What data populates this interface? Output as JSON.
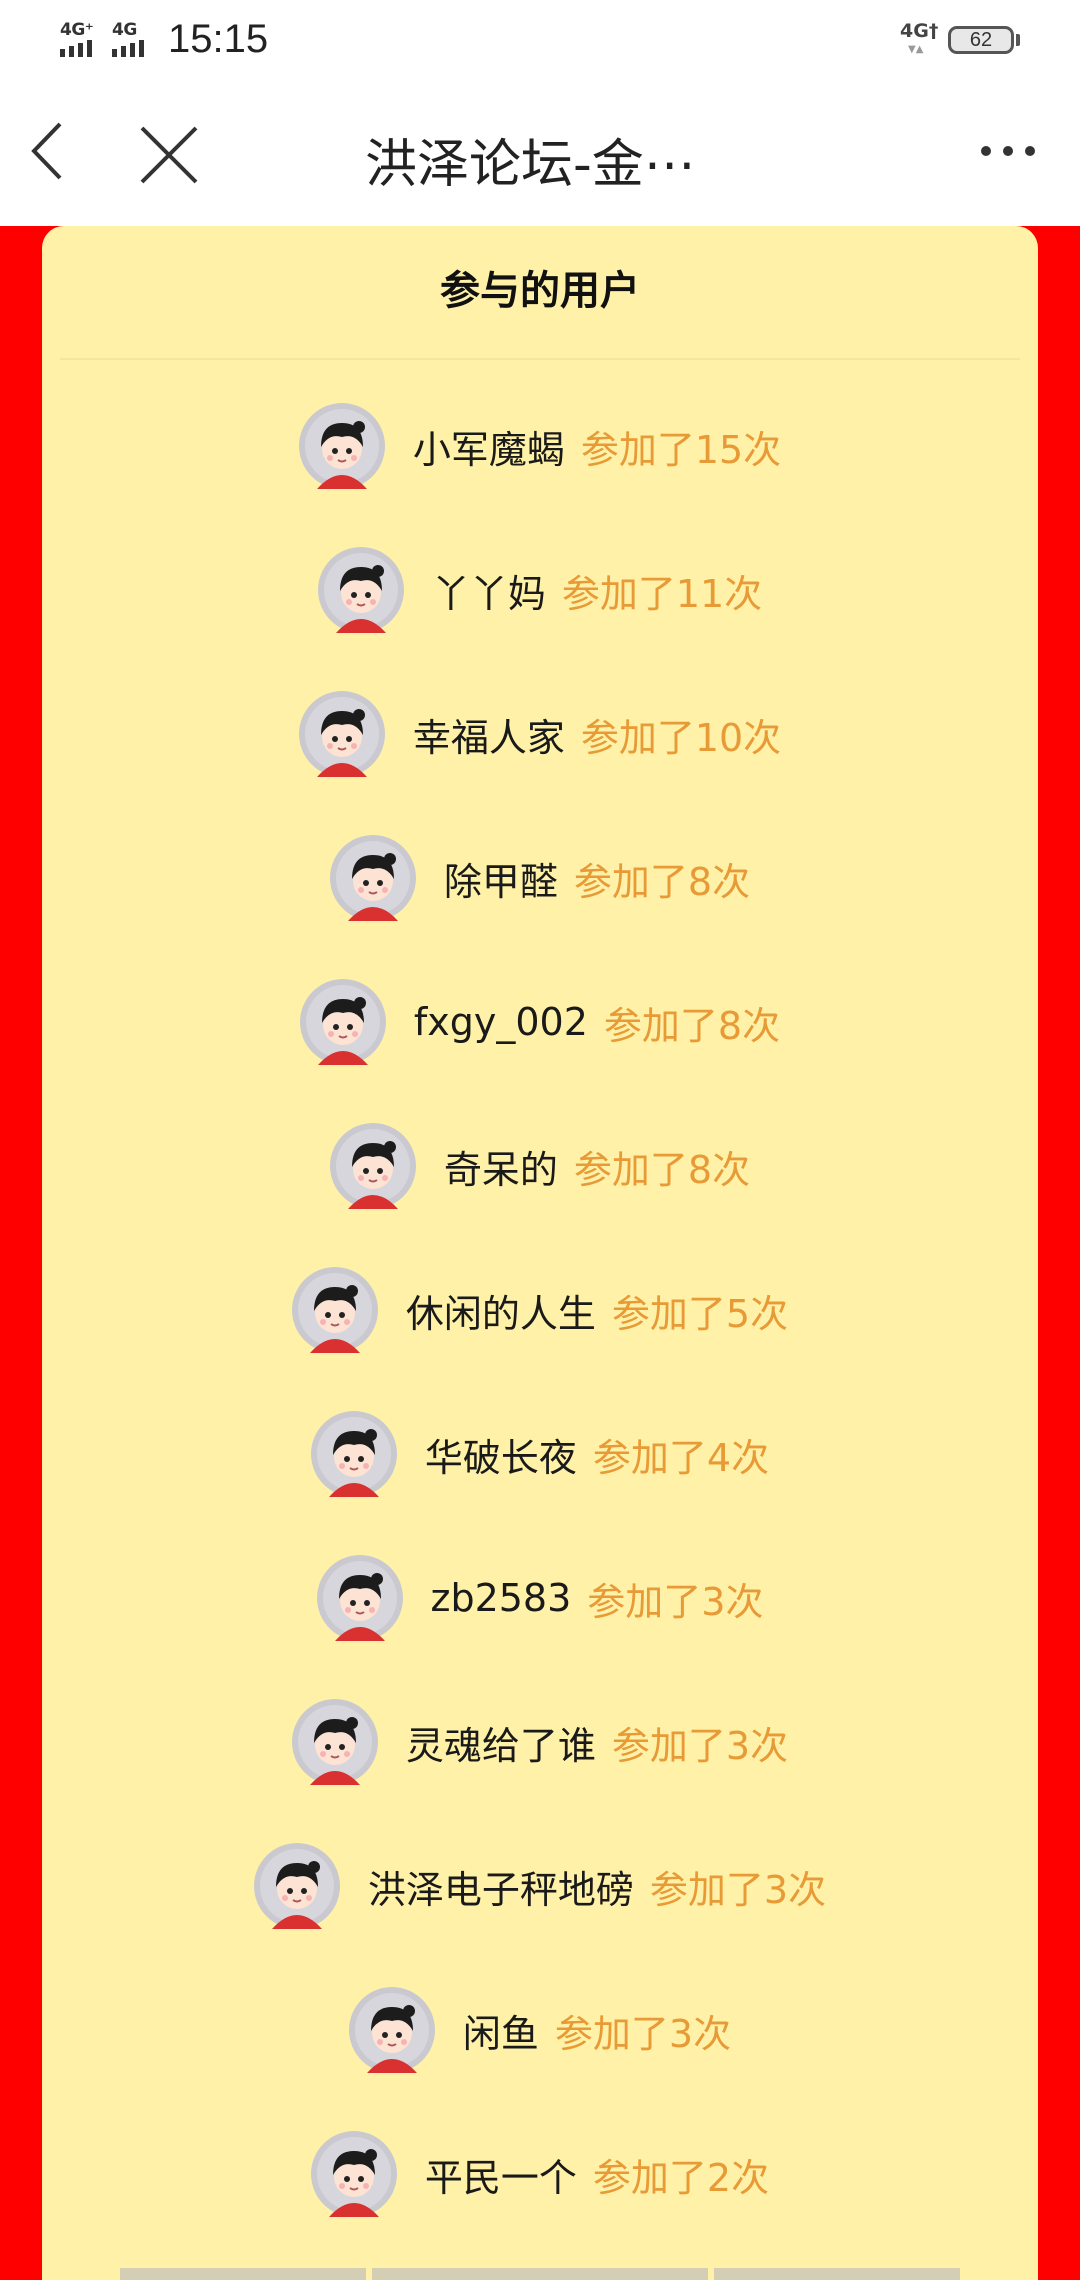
{
  "status_bar": {
    "sim1_label": "4G⁺",
    "sim2_label": "4G",
    "time": "15:15",
    "network_right": "4G†",
    "battery": "62"
  },
  "nav": {
    "title": "洪泽论坛-金⋯"
  },
  "card": {
    "title": "参与的用户"
  },
  "users": [
    {
      "name": "小军魔蝎",
      "count": "参加了15次"
    },
    {
      "name": "丫丫妈",
      "count": "参加了11次"
    },
    {
      "name": "幸福人家",
      "count": "参加了10次"
    },
    {
      "name": "除甲醛",
      "count": "参加了8次"
    },
    {
      "name": "fxgy_002",
      "count": "参加了8次"
    },
    {
      "name": "奇呆的",
      "count": "参加了8次"
    },
    {
      "name": "休闲的人生",
      "count": "参加了5次"
    },
    {
      "name": "华破长夜",
      "count": "参加了4次"
    },
    {
      "name": "zb2583",
      "count": "参加了3次"
    },
    {
      "name": "灵魂给了谁",
      "count": "参加了3次"
    },
    {
      "name": "洪泽电子秤地磅",
      "count": "参加了3次"
    },
    {
      "name": "闲鱼",
      "count": "参加了3次"
    },
    {
      "name": "平民一个",
      "count": "参加了2次"
    }
  ],
  "colors": {
    "page_background": "#ff0000",
    "card_background": "#fff2a8",
    "count_text": "#e89a36"
  }
}
